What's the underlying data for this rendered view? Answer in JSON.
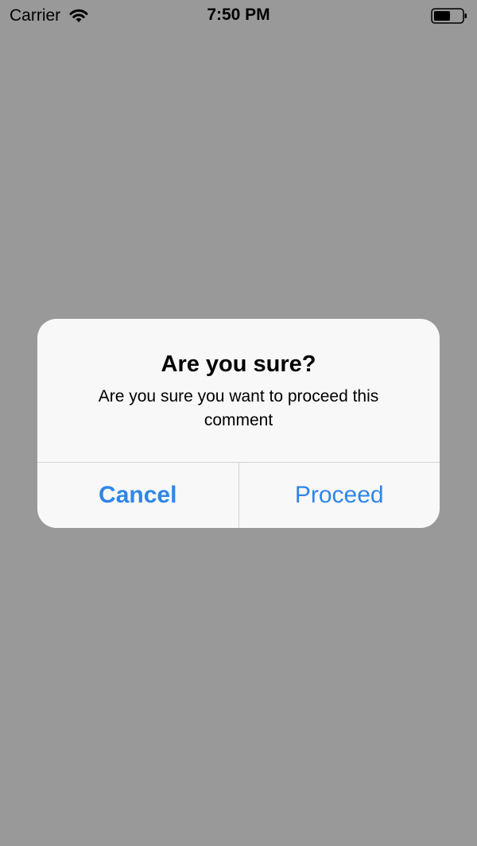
{
  "status_bar": {
    "carrier": "Carrier",
    "time": "7:50 PM",
    "wifi_icon": "wifi-icon",
    "battery_icon": "battery-icon"
  },
  "alert": {
    "title": "Are you sure?",
    "message": "Are you sure you want to proceed this comment",
    "cancel_label": "Cancel",
    "proceed_label": "Proceed"
  },
  "colors": {
    "overlay": "#999999",
    "alert_background": "#f8f8f8",
    "accent": "#2f86e8"
  }
}
